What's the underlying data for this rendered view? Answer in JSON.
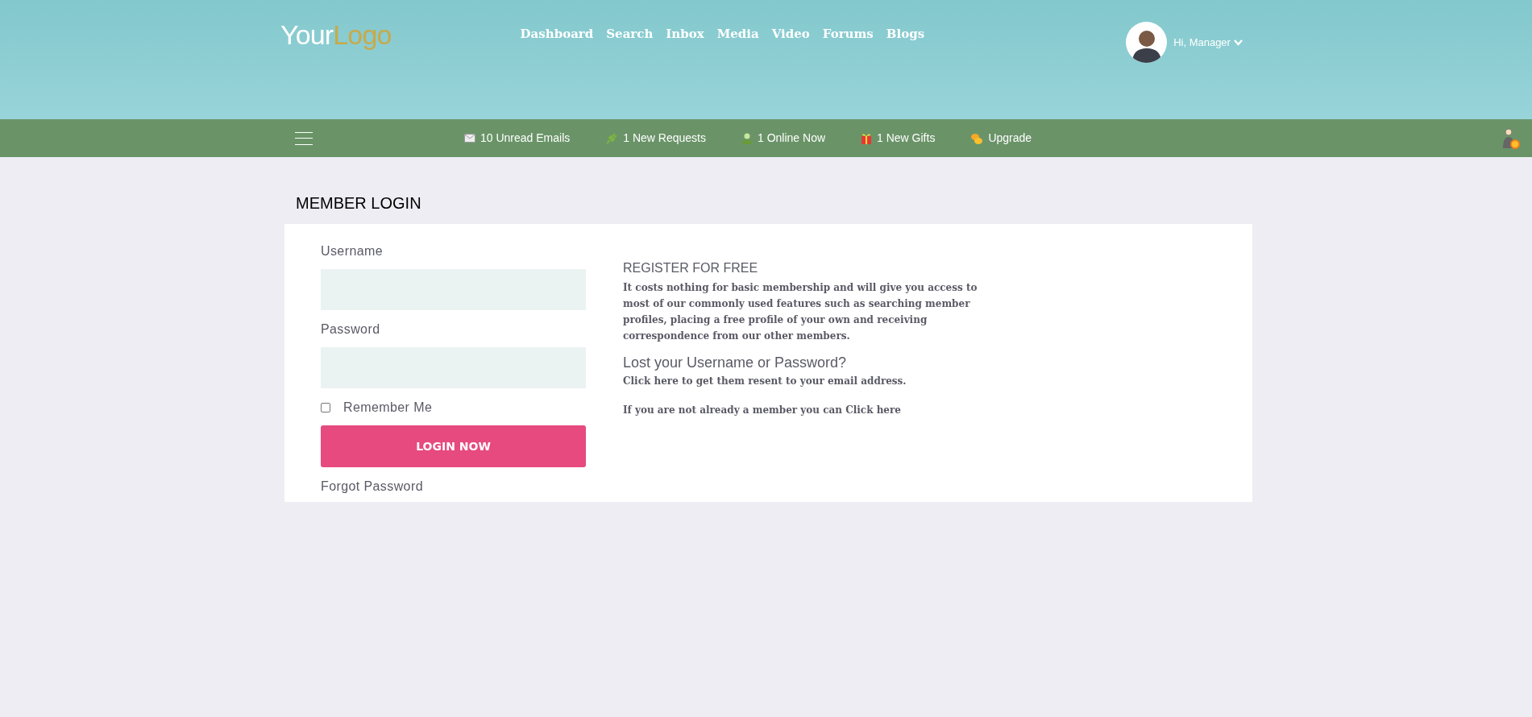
{
  "header": {
    "logo": {
      "first": "Your",
      "second": "Logo"
    },
    "nav": [
      "Dashboard",
      "Search",
      "Inbox",
      "Media",
      "Video",
      "Forums",
      "Blogs"
    ],
    "user": {
      "greeting": "Hi, Manager"
    }
  },
  "toolbar": {
    "items": [
      {
        "kind": "mail",
        "label": "10 Unread Emails"
      },
      {
        "kind": "plug",
        "label": "1 New Requests"
      },
      {
        "kind": "person",
        "label": "1 Online Now"
      },
      {
        "kind": "gift",
        "label": "1 New Gifts"
      },
      {
        "kind": "coins",
        "label": "Upgrade"
      }
    ]
  },
  "login": {
    "title": "MEMBER LOGIN",
    "username_label": "Username",
    "password_label": "Password",
    "remember": {
      "label": "Remember Me",
      "checked": false
    },
    "button": "LOGIN NOW",
    "forgot": "Forgot Password"
  },
  "info": {
    "register_title": "REGISTER FOR FREE",
    "register_text": "It costs nothing for basic membership and will give you access to most of our commonly used features such as searching member profiles, placing a free profile of your own and receiving correspondence from our other members.",
    "lost_title": "Lost your Username or Password?",
    "lost_text": "Click here to get them resent to your email address.",
    "member_text": "If you are not already a member you can Click here"
  }
}
